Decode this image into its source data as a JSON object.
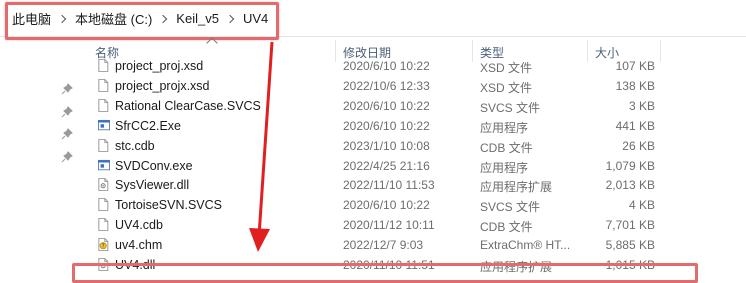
{
  "address_bar": {
    "breadcrumbs": [
      "此电脑",
      "本地磁盘 (C:)",
      "Keil_v5",
      "UV4"
    ]
  },
  "columns": {
    "name": "名称",
    "modified": "修改日期",
    "type": "类型",
    "size": "大小"
  },
  "files": [
    {
      "name": "project_proj.xsd",
      "modified": "2020/6/10 10:22",
      "type": "XSD 文件",
      "size": "107 KB",
      "icon": "xsd-file-icon"
    },
    {
      "name": "project_projx.xsd",
      "modified": "2022/10/6 12:33",
      "type": "XSD 文件",
      "size": "138 KB",
      "icon": "xsd-file-icon"
    },
    {
      "name": "Rational ClearCase.SVCS",
      "modified": "2020/6/10 10:22",
      "type": "SVCS 文件",
      "size": "3 KB",
      "icon": "svcs-file-icon"
    },
    {
      "name": "SfrCC2.Exe",
      "modified": "2020/6/10 10:22",
      "type": "应用程序",
      "size": "441 KB",
      "icon": "exe-icon"
    },
    {
      "name": "stc.cdb",
      "modified": "2023/1/10 10:08",
      "type": "CDB 文件",
      "size": "26 KB",
      "icon": "cdb-file-icon"
    },
    {
      "name": "SVDConv.exe",
      "modified": "2022/4/25 21:16",
      "type": "应用程序",
      "size": "1,079 KB",
      "icon": "exe-icon"
    },
    {
      "name": "SysViewer.dll",
      "modified": "2022/11/10 11:53",
      "type": "应用程序扩展",
      "size": "2,013 KB",
      "icon": "dll-icon"
    },
    {
      "name": "TortoiseSVN.SVCS",
      "modified": "2020/6/10 10:22",
      "type": "SVCS 文件",
      "size": "4 KB",
      "icon": "svcs-file-icon"
    },
    {
      "name": "UV4.cdb",
      "modified": "2020/11/12 10:11",
      "type": "CDB 文件",
      "size": "7,701 KB",
      "icon": "cdb-file-icon"
    },
    {
      "name": "uv4.chm",
      "modified": "2022/12/7 9:03",
      "type": "ExtraChm® HT...",
      "size": "5,885 KB",
      "icon": "chm-help-icon"
    },
    {
      "name": "UV4.dll",
      "modified": "2020/11/10 11:51",
      "type": "应用程序扩展",
      "size": "1,015 KB",
      "icon": "dll-icon"
    }
  ],
  "colors": {
    "highlight_border": "#e36b6b",
    "arrow": "#e02020",
    "header_text": "#4c607a"
  }
}
